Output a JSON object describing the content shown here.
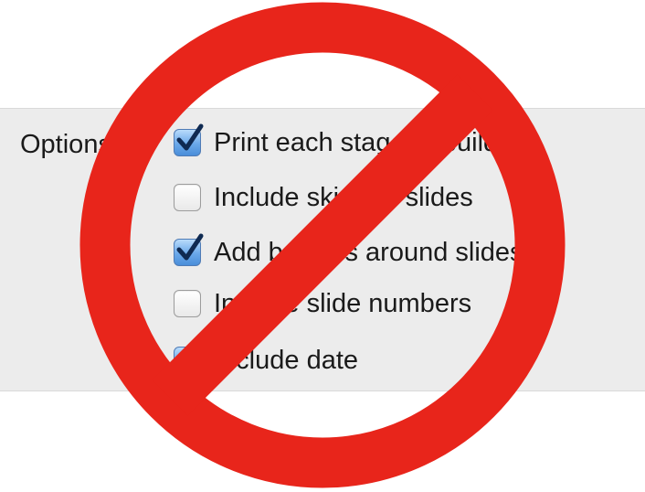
{
  "options_label": "Options:",
  "options": [
    {
      "label": "Print each stage of builds",
      "checked": true
    },
    {
      "label": "Include skipped slides",
      "checked": false
    },
    {
      "label": "Add borders around slides",
      "checked": true
    },
    {
      "label": "Include slide numbers",
      "checked": false
    },
    {
      "label": "Include date",
      "checked": true
    }
  ],
  "prohibition_color": "#e8251b",
  "checkbox_on_color": "#5b9de3"
}
